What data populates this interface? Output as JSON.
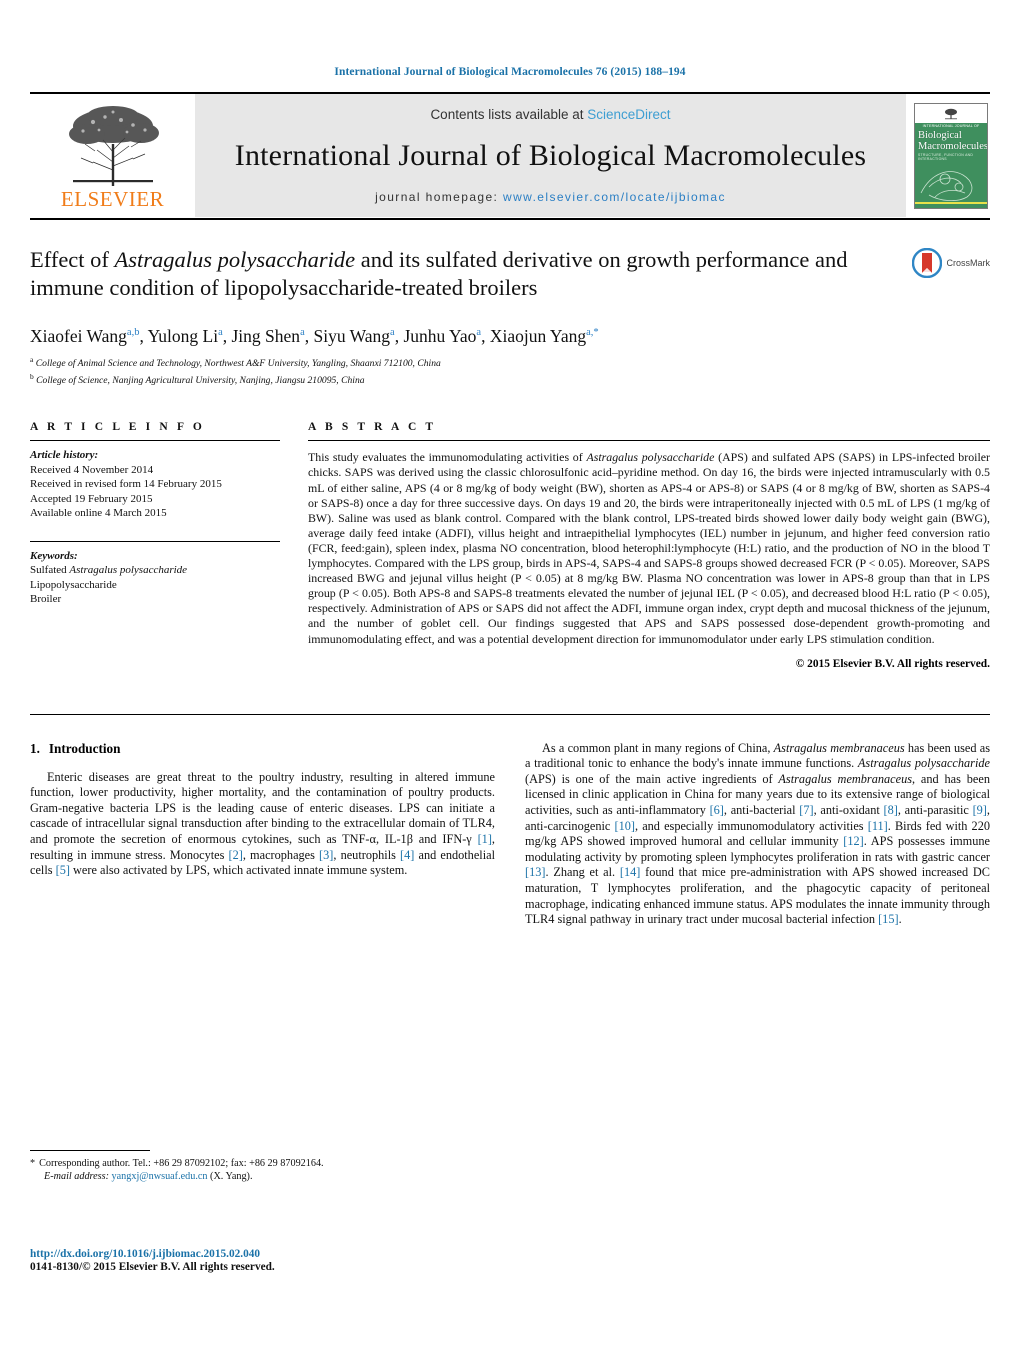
{
  "running_head": "International Journal of Biological Macromolecules 76 (2015) 188–194",
  "masthead": {
    "publisher_name": "ELSEVIER",
    "contents_prefix": "Contents lists available at ",
    "contents_link": "ScienceDirect",
    "journal_title": "International Journal of Biological Macromolecules",
    "homepage_prefix": "journal homepage: ",
    "homepage_url": "www.elsevier.com/locate/ijbiomac",
    "cover": {
      "publisher_mark": "ELSEVIER",
      "kicker": "INTERNATIONAL JOURNAL OF",
      "name_line1": "Biological",
      "name_line2": "Macromolecules",
      "subtitle": "STRUCTURE, FUNCTION AND INTERACTIONS"
    }
  },
  "article": {
    "title_part1": "Effect of ",
    "title_italic1": "Astragalus polysaccharide",
    "title_part2": " and its sulfated derivative on growth performance and immune condition of lipopolysaccharide-treated broilers",
    "crossmark_label": "CrossMark",
    "authors": [
      {
        "name": "Xiaofei Wang",
        "sup": "a,b"
      },
      {
        "name": "Yulong Li",
        "sup": "a"
      },
      {
        "name": "Jing Shen",
        "sup": "a"
      },
      {
        "name": "Siyu Wang",
        "sup": "a"
      },
      {
        "name": "Junhu Yao",
        "sup": "a"
      },
      {
        "name": "Xiaojun Yang",
        "sup": "a,*"
      }
    ],
    "affiliations": [
      {
        "marker": "a",
        "text": "College of Animal Science and Technology, Northwest A&F University, Yangling, Shaanxi 712100, China"
      },
      {
        "marker": "b",
        "text": "College of Science, Nanjing Agricultural University, Nanjing, Jiangsu 210095, China"
      }
    ]
  },
  "article_info": {
    "heading": "A R T I C L E   I N F O",
    "history_label": "Article history:",
    "history": [
      "Received 4 November 2014",
      "Received in revised form 14 February 2015",
      "Accepted 19 February 2015",
      "Available online 4 March 2015"
    ],
    "keywords_label": "Keywords:",
    "keywords": [
      "Sulfated Astragalus polysaccharide",
      "Lipopolysaccharide",
      "Broiler"
    ],
    "keyword_italic_part": "Astragalus polysaccharide",
    "keyword_plain_prefix": "Sulfated "
  },
  "abstract": {
    "heading": "A B S T R A C T",
    "text_p1": "This study evaluates the immunomodulating activities of ",
    "text_italic1": "Astragalus polysaccharide",
    "text_p2": " (APS) and sulfated APS (SAPS) in LPS-infected broiler chicks. SAPS was derived using the classic chlorosulfonic acid–pyridine method. On day 16, the birds were injected intramuscularly with 0.5 mL of either saline, APS (4 or 8 mg/kg of body weight (BW), shorten as APS-4 or APS-8) or SAPS (4 or 8 mg/kg of BW, shorten as SAPS-4 or SAPS-8) once a day for three successive days. On days 19 and 20, the birds were intraperitoneally injected with 0.5 mL of LPS (1 mg/kg of BW). Saline was used as blank control. Compared with the blank control, LPS-treated birds showed lower daily body weight gain (BWG), average daily feed intake (ADFI), villus height and intraepithelial lymphocytes (IEL) number in jejunum, and higher feed conversion ratio (FCR, feed:gain), spleen index, plasma NO concentration, blood heterophil:lymphocyte (H:L) ratio, and the production of NO in the blood T lymphocytes. Compared with the LPS group, birds in APS-4, SAPS-4 and SAPS-8 groups showed decreased FCR (P < 0.05). Moreover, SAPS increased BWG and jejunal villus height (P < 0.05) at 8 mg/kg BW. Plasma NO concentration was lower in APS-8 group than that in LPS group (P < 0.05). Both APS-8 and SAPS-8 treatments elevated the number of jejunal IEL (P < 0.05), and decreased blood H:L ratio (P < 0.05), respectively. Administration of APS or SAPS did not affect the ADFI, immune organ index, crypt depth and mucosal thickness of the jejunum, and the number of goblet cell. Our findings suggested that APS and SAPS possessed dose-dependent growth-promoting and immunomodulating effect, and was a potential development direction for immunomodulator under early LPS stimulation condition.",
    "copyright": "© 2015 Elsevier B.V. All rights reserved."
  },
  "introduction": {
    "number": "1.",
    "title": "Introduction",
    "left_paragraph": {
      "seg1": "Enteric diseases are great threat to the poultry industry, resulting in altered immune function, lower productivity, higher mortality, and the contamination of poultry products. Gram-negative bacteria LPS is the leading cause of enteric diseases. LPS can initiate a cascade of intracellular signal transduction after binding to the extracellular domain of TLR4, and promote the secretion of enormous cytokines, such as TNF-α, IL-1β and IFN-γ ",
      "ref1": "[1]",
      "seg2": ", resulting in immune stress. Monocytes ",
      "ref2": "[2]",
      "seg3": ", macrophages ",
      "ref3": "[3]",
      "seg4": ", neutrophils ",
      "ref4": "[4]",
      "seg5": " and endothelial cells ",
      "ref5": "[5]",
      "seg6": " were also activated by LPS, which activated innate immune system."
    },
    "right_paragraph": {
      "seg1": "As a common plant in many regions of China, ",
      "italic1": "Astragalus membranaceus",
      "seg2": " has been used as a traditional tonic to enhance the body's innate immune functions. ",
      "italic2": "Astragalus polysaccharide",
      "seg3": " (APS) is one of the main active ingredients of ",
      "italic3": "Astragalus membranaceus",
      "seg4": ", and has been licensed in clinic application in China for many years due to its extensive range of biological activities, such as anti-inflammatory ",
      "ref6": "[6]",
      "seg5": ", anti-bacterial ",
      "ref7": "[7]",
      "seg6": ", anti-oxidant ",
      "ref8": "[8]",
      "seg7": ", anti-parasitic ",
      "ref9": "[9]",
      "seg8": ", anti-carcinogenic ",
      "ref10": "[10]",
      "seg9": ", and especially immunomodulatory activities ",
      "ref11": "[11]",
      "seg10": ". Birds fed with 220 mg/kg APS showed improved humoral and cellular immunity ",
      "ref12": "[12]",
      "seg11": ". APS possesses immune modulating activity by promoting spleen lymphocytes proliferation in rats with gastric cancer ",
      "ref13": "[13]",
      "seg12": ". Zhang et al. ",
      "ref14": "[14]",
      "seg13": " found that mice pre-administration with APS showed increased DC maturation, T lymphocytes proliferation, and the phagocytic capacity of peritoneal macrophage, indicating enhanced immune status. APS modulates the innate immunity through TLR4 signal pathway in urinary tract under mucosal bacterial infection ",
      "ref15": "[15]",
      "seg14": "."
    }
  },
  "footer": {
    "corresponding_star": "*",
    "corresponding_text": "Corresponding author. Tel.: +86 29 87092102; fax: +86 29 87092164.",
    "email_label": "E-mail address:",
    "email": "yangxj@nwsuaf.edu.cn",
    "email_suffix": " (X. Yang).",
    "doi_url": "http://dx.doi.org/10.1016/j.ijbiomac.2015.02.040",
    "issn_line": "0141-8130/© 2015 Elsevier B.V. All rights reserved."
  },
  "colors": {
    "link_blue": "#1b72a8",
    "elsevier_orange": "#f07c19",
    "cover_green": "#3f8f5e",
    "sciencedirect_blue": "#3e9ed2"
  }
}
